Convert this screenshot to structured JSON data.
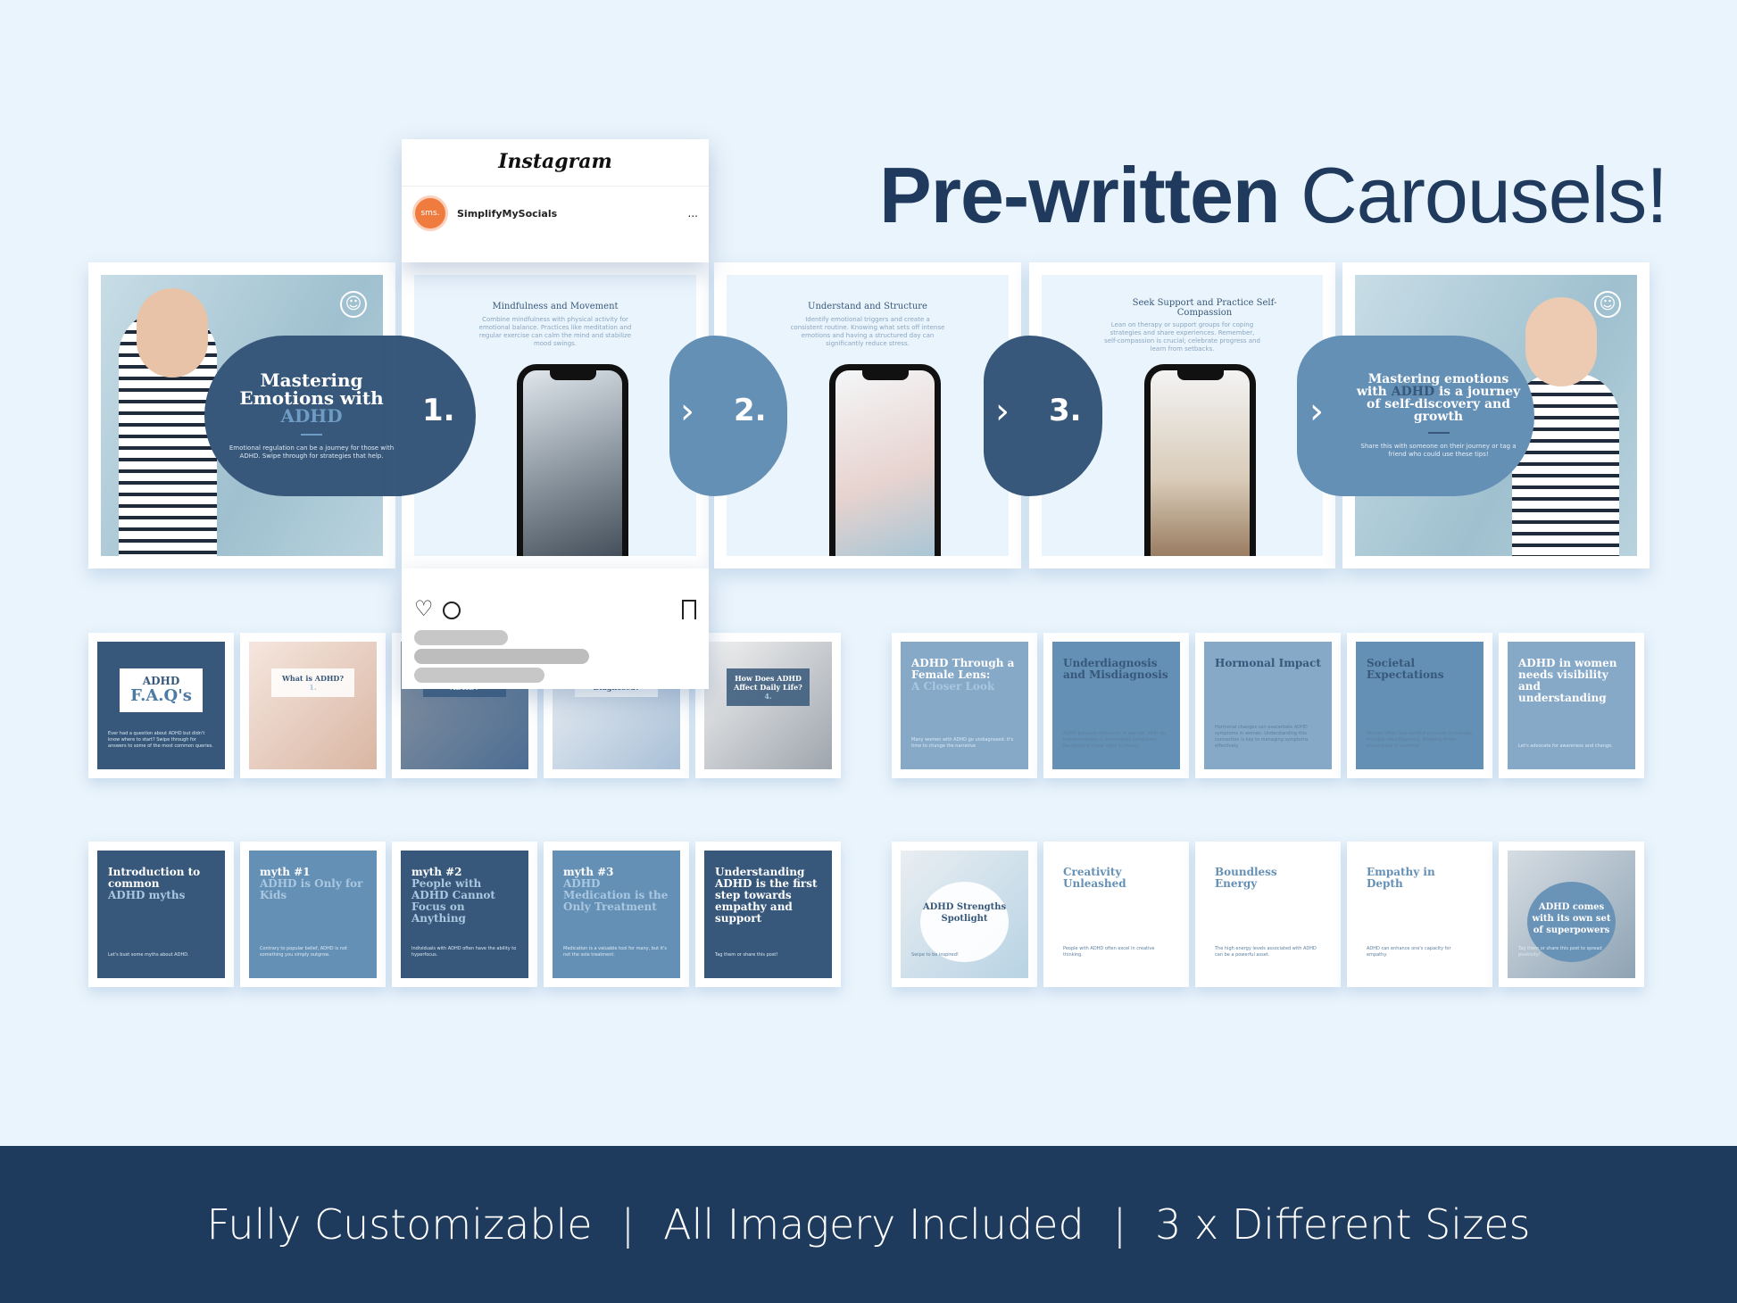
{
  "title": {
    "bold": "Pre-written",
    "light": "Carousels!"
  },
  "colors": {
    "navy": "#37587a",
    "mid_blue": "#6590b5",
    "background": "#eaf4fc",
    "footer": "#1e3a5c"
  },
  "instagram": {
    "logo": "Instagram",
    "avatar": "sms.",
    "account": "SimplifyMySocials",
    "more": "...",
    "icons": [
      "heart-icon",
      "comment-icon",
      "bookmark-icon"
    ]
  },
  "top_carousel": {
    "cover": {
      "title_1": "Mastering Emotions with",
      "title_accent": "ADHD",
      "body": "Emotional regulation can be a journey for those with ADHD. Swipe through for strategies that help.",
      "icon": "smiley-icon"
    },
    "slides": [
      {
        "number": "1.",
        "heading": "Mindfulness and Movement",
        "body": "Combine mindfulness with physical activity for emotional balance. Practices like meditation and regular exercise can calm the mind and stabilize mood swings."
      },
      {
        "number": "2.",
        "heading": "Understand and Structure",
        "body": "Identify emotional triggers and create a consistent routine. Knowing what sets off intense emotions and having a structured day can significantly reduce stress."
      },
      {
        "number": "3.",
        "heading": "Seek Support and Practice Self-Compassion",
        "body": "Lean on therapy or support groups for coping strategies and share experiences. Remember, self-compassion is crucial; celebrate progress and learn from setbacks."
      }
    ],
    "closing": {
      "title_accent": "ADHD",
      "title_pre": "Mastering emotions with",
      "title_post": "is a journey of self-discovery and growth",
      "body": "Share this with someone on their journey or tag a friend who could use these tips!"
    }
  },
  "faq_row": [
    {
      "title": "ADHD",
      "big": "F.A.Q's",
      "body": "Ever had a question about ADHD but didn't know where to start? Swipe through for answers to some of the most common queries."
    },
    {
      "badge": "1.",
      "title": "What is ADHD?"
    },
    {
      "title": "Can Adults Have ADHD?"
    },
    {
      "title": "How is ADHD Diagnosed?"
    },
    {
      "badge": "4.",
      "title": "How Does ADHD Affect Daily Life?"
    }
  ],
  "women_row": [
    {
      "title": "ADHD Through a Female Lens:",
      "sub": "A Closer Look",
      "body": "Many women with ADHD go undiagnosed. It's time to change the narrative"
    },
    {
      "title": "Underdiagnosis and Misdiagnosis",
      "body": "ADHD presents differently in women, often as inattentiveness or internalized symptoms. Recognizing these signs is crucial."
    },
    {
      "title": "Hormonal Impact",
      "body": "Hormonal changes can exacerbate ADHD symptoms in women. Understanding this connection is key to managing symptoms effectively."
    },
    {
      "title": "Societal Expectations",
      "body": "Women often face societal pressure to manage multiple roles flawlessly. Breaking these stereotypes is essential."
    },
    {
      "title": "ADHD in women needs visibility and understanding",
      "body": "Let's advocate for awareness and change."
    }
  ],
  "myths_row": [
    {
      "title": "Introduction to common",
      "accent": "ADHD myths",
      "body": "Let's bust some myths about ADHD."
    },
    {
      "title": "myth #1",
      "accent": "ADHD is Only for Kids",
      "body": "Contrary to popular belief, ADHD is not something you simply outgrow."
    },
    {
      "title": "myth #2",
      "accent": "People with ADHD Cannot Focus on Anything",
      "body": "Individuals with ADHD often have the ability to hyperfocus."
    },
    {
      "title": "myth #3",
      "accent": "ADHD Medication is the Only Treatment",
      "body": "Medication is a valuable tool for many, but it's not the sole treatment."
    },
    {
      "title": "Understanding ADHD is the first step towards empathy and support",
      "body": "Tag them or share this post!"
    }
  ],
  "strengths_row": [
    {
      "title": "ADHD Strengths Spotlight",
      "body": "Swipe to be inspired!"
    },
    {
      "title": "Creativity Unleashed",
      "body": "People with ADHD often excel in creative thinking."
    },
    {
      "title": "Boundless Energy",
      "body": "The high energy levels associated with ADHD can be a powerful asset."
    },
    {
      "title": "Empathy in Depth",
      "body": "ADHD can enhance one's capacity for empathy."
    },
    {
      "title": "ADHD comes with its own set of superpowers",
      "body": "Tag them or share this post to spread positivity!"
    }
  ],
  "footer": {
    "items": [
      "Fully Customizable",
      "All Imagery Included",
      "3 x Different Sizes"
    ],
    "separator": "|"
  }
}
